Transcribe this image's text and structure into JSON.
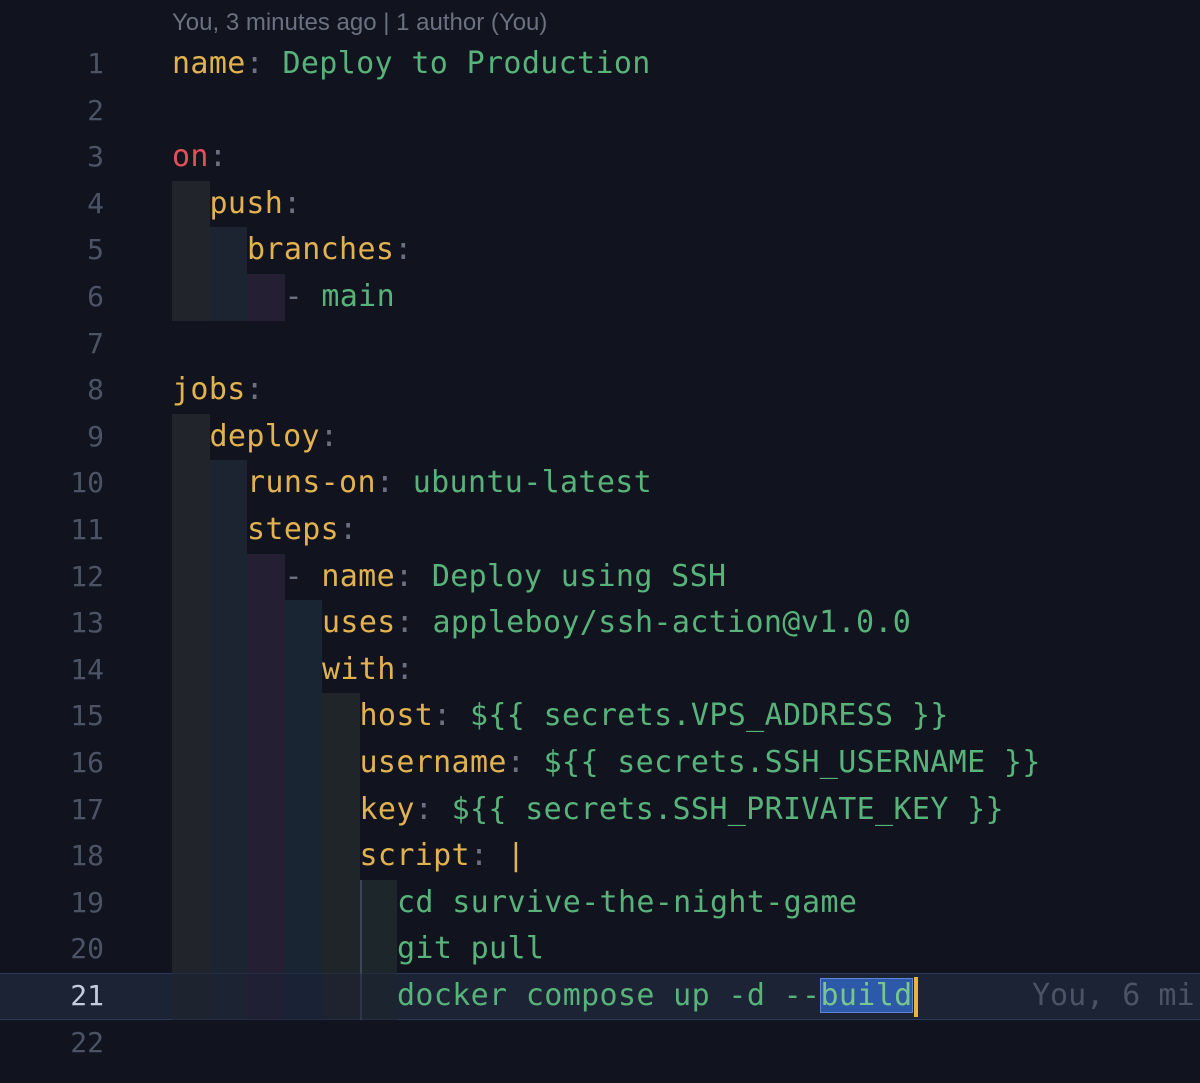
{
  "blame_header": "You, 3 minutes ago | 1 author (You)",
  "inline_blame": "You, 6 mi",
  "current_line": 21,
  "lines": [
    {
      "num": "1",
      "indent": 0,
      "guides": [],
      "tokens": [
        {
          "t": "name",
          "c": "key"
        },
        {
          "t": ": ",
          "c": "punc"
        },
        {
          "t": "Deploy to Production",
          "c": "str"
        }
      ]
    },
    {
      "num": "2",
      "indent": 0,
      "guides": [],
      "tokens": []
    },
    {
      "num": "3",
      "indent": 0,
      "guides": [],
      "tokens": [
        {
          "t": "on",
          "c": "kw"
        },
        {
          "t": ":",
          "c": "punc"
        }
      ]
    },
    {
      "num": "4",
      "indent": 1,
      "guides": [
        0
      ],
      "tokens": [
        {
          "t": "push",
          "c": "key"
        },
        {
          "t": ":",
          "c": "punc"
        }
      ]
    },
    {
      "num": "5",
      "indent": 2,
      "guides": [
        0,
        1
      ],
      "tokens": [
        {
          "t": "branches",
          "c": "key"
        },
        {
          "t": ":",
          "c": "punc"
        }
      ]
    },
    {
      "num": "6",
      "indent": 3,
      "guides": [
        0,
        1,
        2
      ],
      "tokens": [
        {
          "t": "- ",
          "c": "punc"
        },
        {
          "t": "main",
          "c": "str"
        }
      ]
    },
    {
      "num": "7",
      "indent": 0,
      "guides": [],
      "tokens": []
    },
    {
      "num": "8",
      "indent": 0,
      "guides": [],
      "tokens": [
        {
          "t": "jobs",
          "c": "key"
        },
        {
          "t": ":",
          "c": "punc"
        }
      ]
    },
    {
      "num": "9",
      "indent": 1,
      "guides": [
        0
      ],
      "tokens": [
        {
          "t": "deploy",
          "c": "key"
        },
        {
          "t": ":",
          "c": "punc"
        }
      ]
    },
    {
      "num": "10",
      "indent": 2,
      "guides": [
        0,
        1
      ],
      "tokens": [
        {
          "t": "runs-on",
          "c": "key"
        },
        {
          "t": ": ",
          "c": "punc"
        },
        {
          "t": "ubuntu-latest",
          "c": "str"
        }
      ]
    },
    {
      "num": "11",
      "indent": 2,
      "guides": [
        0,
        1
      ],
      "tokens": [
        {
          "t": "steps",
          "c": "key"
        },
        {
          "t": ":",
          "c": "punc"
        }
      ]
    },
    {
      "num": "12",
      "indent": 3,
      "guides": [
        0,
        1,
        2
      ],
      "tokens": [
        {
          "t": "- ",
          "c": "punc"
        },
        {
          "t": "name",
          "c": "key"
        },
        {
          "t": ": ",
          "c": "punc"
        },
        {
          "t": "Deploy using SSH",
          "c": "str"
        }
      ]
    },
    {
      "num": "13",
      "indent": 4,
      "guides": [
        0,
        1,
        2,
        3
      ],
      "tokens": [
        {
          "t": "uses",
          "c": "key"
        },
        {
          "t": ": ",
          "c": "punc"
        },
        {
          "t": "appleboy/ssh-action@v1.0.0",
          "c": "str"
        }
      ]
    },
    {
      "num": "14",
      "indent": 4,
      "guides": [
        0,
        1,
        2,
        3
      ],
      "tokens": [
        {
          "t": "with",
          "c": "key"
        },
        {
          "t": ":",
          "c": "punc"
        }
      ]
    },
    {
      "num": "15",
      "indent": 5,
      "guides": [
        0,
        1,
        2,
        3,
        4
      ],
      "tokens": [
        {
          "t": "host",
          "c": "key"
        },
        {
          "t": ": ",
          "c": "punc"
        },
        {
          "t": "${{ secrets.VPS_ADDRESS }}",
          "c": "str"
        }
      ]
    },
    {
      "num": "16",
      "indent": 5,
      "guides": [
        0,
        1,
        2,
        3,
        4
      ],
      "tokens": [
        {
          "t": "username",
          "c": "key"
        },
        {
          "t": ": ",
          "c": "punc"
        },
        {
          "t": "${{ secrets.SSH_USERNAME }}",
          "c": "str"
        }
      ]
    },
    {
      "num": "17",
      "indent": 5,
      "guides": [
        0,
        1,
        2,
        3,
        4
      ],
      "tokens": [
        {
          "t": "key",
          "c": "key"
        },
        {
          "t": ": ",
          "c": "punc"
        },
        {
          "t": "${{ secrets.SSH_PRIVATE_KEY }}",
          "c": "str"
        }
      ]
    },
    {
      "num": "18",
      "indent": 5,
      "guides": [
        0,
        1,
        2,
        3,
        4
      ],
      "tokens": [
        {
          "t": "script",
          "c": "key"
        },
        {
          "t": ": ",
          "c": "punc"
        },
        {
          "t": "|",
          "c": "pipe"
        }
      ]
    },
    {
      "num": "19",
      "indent": 6,
      "guides": [
        0,
        1,
        2,
        3,
        4,
        5
      ],
      "tokens": [
        {
          "t": "cd survive-the-night-game",
          "c": "str"
        }
      ]
    },
    {
      "num": "20",
      "indent": 6,
      "guides": [
        0,
        1,
        2,
        3,
        4,
        5
      ],
      "tokens": [
        {
          "t": "git pull",
          "c": "str"
        }
      ]
    },
    {
      "num": "21",
      "indent": 6,
      "guides": [
        0,
        1,
        2,
        3,
        4,
        5
      ],
      "tokens": [
        {
          "t": "docker compose up -d --",
          "c": "str"
        },
        {
          "t": "build",
          "c": "str sel"
        }
      ]
    },
    {
      "num": "22",
      "indent": 0,
      "guides": [],
      "tokens": []
    }
  ]
}
